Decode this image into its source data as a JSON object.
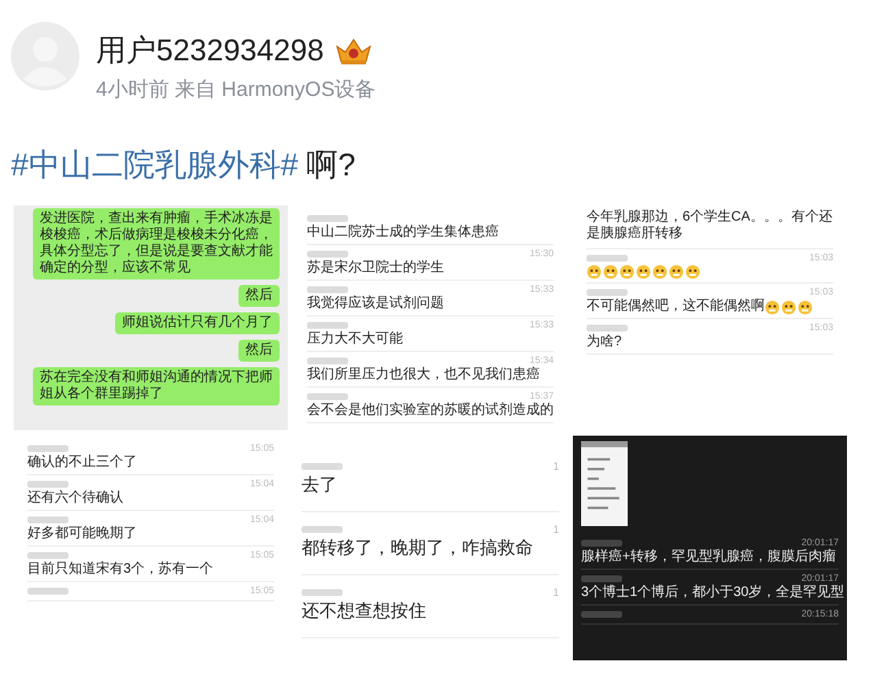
{
  "author": {
    "name": "用户5232934298",
    "meta": "4小时前 来自 HarmonyOS设备"
  },
  "title": {
    "hashtag": "#中山二院乳腺外科#",
    "text": "啊?"
  },
  "images": [
    {
      "kind": "bubbles",
      "messages": [
        "发进医院，查出来有肿瘤，手术冰冻是梭梭癌，术后做病理是梭梭未分化癌，具体分型忘了，但是说是要查文献才能确定的分型，应该不常见",
        "然后",
        "师姐说估计只有几个月了",
        "然后",
        "苏在完全没有和师姐沟通的情况下把师姐从各个群里踢掉了"
      ]
    },
    {
      "kind": "comments",
      "items": [
        {
          "text": "中山二院苏士成的学生集体患癌"
        },
        {
          "time": "15:30",
          "text": "苏是宋尔卫院士的学生"
        },
        {
          "time": "15:33",
          "text": "我觉得应该是试剂问题"
        },
        {
          "time": "15:33",
          "text": "压力大不大可能"
        },
        {
          "time": "15:34",
          "text": "我们所里压力也很大，也不见我们患癌"
        },
        {
          "time": "15:37",
          "text": "会不会是他们实验室的苏暖的试剂造成的"
        }
      ]
    },
    {
      "kind": "comments",
      "intro": "今年乳腺那边，6个学生CA。。。有个还是胰腺癌肝转移",
      "items": [
        {
          "time": "15:03",
          "emojis": [
            {
              "kind": "grin"
            },
            {
              "kind": "grin"
            },
            {
              "kind": "grin"
            },
            {
              "kind": "grin"
            },
            {
              "kind": "grin"
            },
            {
              "kind": "grin"
            },
            {
              "kind": "grin"
            }
          ]
        },
        {
          "time": "15:03",
          "text": "不可能偶然吧，这不能偶然啊",
          "emojis": [
            {
              "kind": "grin"
            },
            {
              "kind": "grin"
            },
            {
              "kind": "grin"
            }
          ]
        },
        {
          "time": "15:03",
          "text": "为啥?"
        }
      ]
    },
    {
      "kind": "comments",
      "items": [
        {
          "time": "15:05",
          "text": "确认的不止三个了"
        },
        {
          "time": "15:04",
          "text": "还有六个待确认"
        },
        {
          "time": "15:04",
          "text": "好多都可能晚期了"
        },
        {
          "time": "15:05",
          "text": "目前只知道宋有3个，苏有一个"
        },
        {
          "time": "15:05"
        }
      ]
    },
    {
      "kind": "replies",
      "items": [
        {
          "count": "1",
          "text": "去了"
        },
        {
          "count": "1",
          "text": "都转移了，晚期了，咋搞救命"
        },
        {
          "count": "1",
          "text": "还不想查想按住"
        }
      ]
    },
    {
      "kind": "dark",
      "items": [
        {
          "time": "20:01:17",
          "text": "腺样癌+转移，罕见型乳腺癌，腹膜后肉瘤"
        },
        {
          "time": "20:01:17",
          "text": "3个博士1个博后，都小于30岁，全是罕见型"
        },
        {
          "time": "20:15:18"
        }
      ]
    }
  ]
}
